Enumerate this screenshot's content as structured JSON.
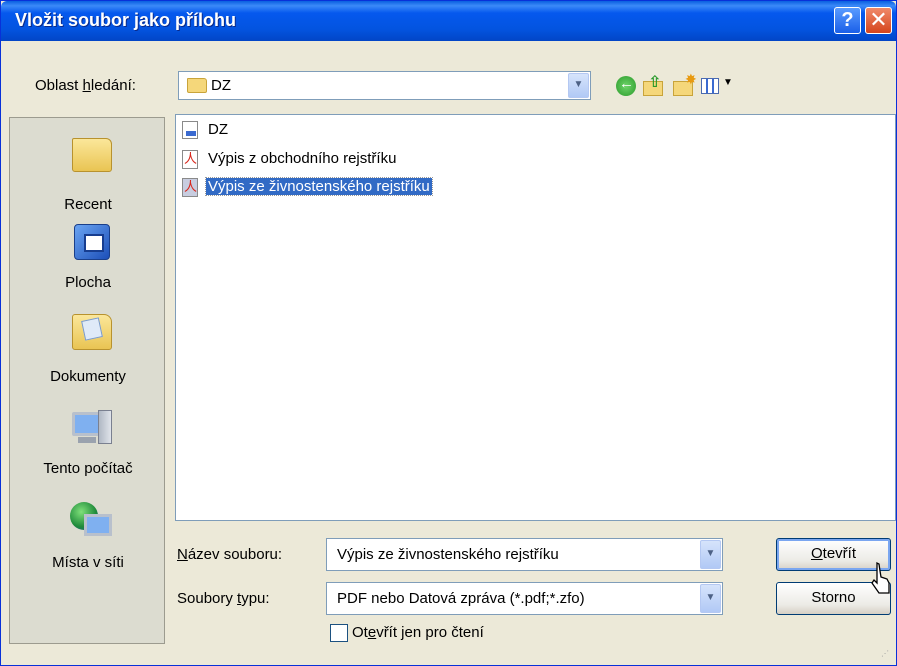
{
  "window": {
    "title": "Vložit soubor jako přílohu",
    "help_label": "?",
    "close_label": "✕"
  },
  "lookin": {
    "label_pre": "Oblast ",
    "label_hotkey": "h",
    "label_post": "ledání:",
    "value": "DZ"
  },
  "toolbar": {
    "icons": [
      "back-icon",
      "up-folder-icon",
      "new-folder-icon",
      "views-menu-icon"
    ]
  },
  "places": [
    {
      "label": "Recent",
      "icon": "folder-icon"
    },
    {
      "label": "Plocha",
      "icon": "desktop-icon"
    },
    {
      "label": "Dokumenty",
      "icon": "documents-icon"
    },
    {
      "label": "Tento počítač",
      "icon": "computer-icon"
    },
    {
      "label": "Místa v síti",
      "icon": "network-icon"
    }
  ],
  "files": [
    {
      "name": "DZ",
      "icon": "dz-file-icon",
      "selected": false
    },
    {
      "name": "Výpis z obchodního rejstříku",
      "icon": "pdf-file-icon",
      "selected": false
    },
    {
      "name": "Výpis ze živnostenského rejstříku",
      "icon": "pdf-file-icon",
      "selected": true
    }
  ],
  "filename": {
    "label_hotkey": "N",
    "label_post": "ázev souboru:",
    "value": "Výpis ze živnostenského rejstříku"
  },
  "filetype": {
    "label_pre": "Soubory ",
    "label_hotkey": "t",
    "label_post": "ypu:",
    "value": "PDF nebo  Datová zpráva (*.pdf;*.zfo)"
  },
  "buttons": {
    "open_hotkey": "O",
    "open_post": "tevřít",
    "cancel": "Storno"
  },
  "readonly": {
    "label_pre": "Ot",
    "label_hotkey": "e",
    "label_post": "vřít jen pro čtení",
    "checked": false
  }
}
